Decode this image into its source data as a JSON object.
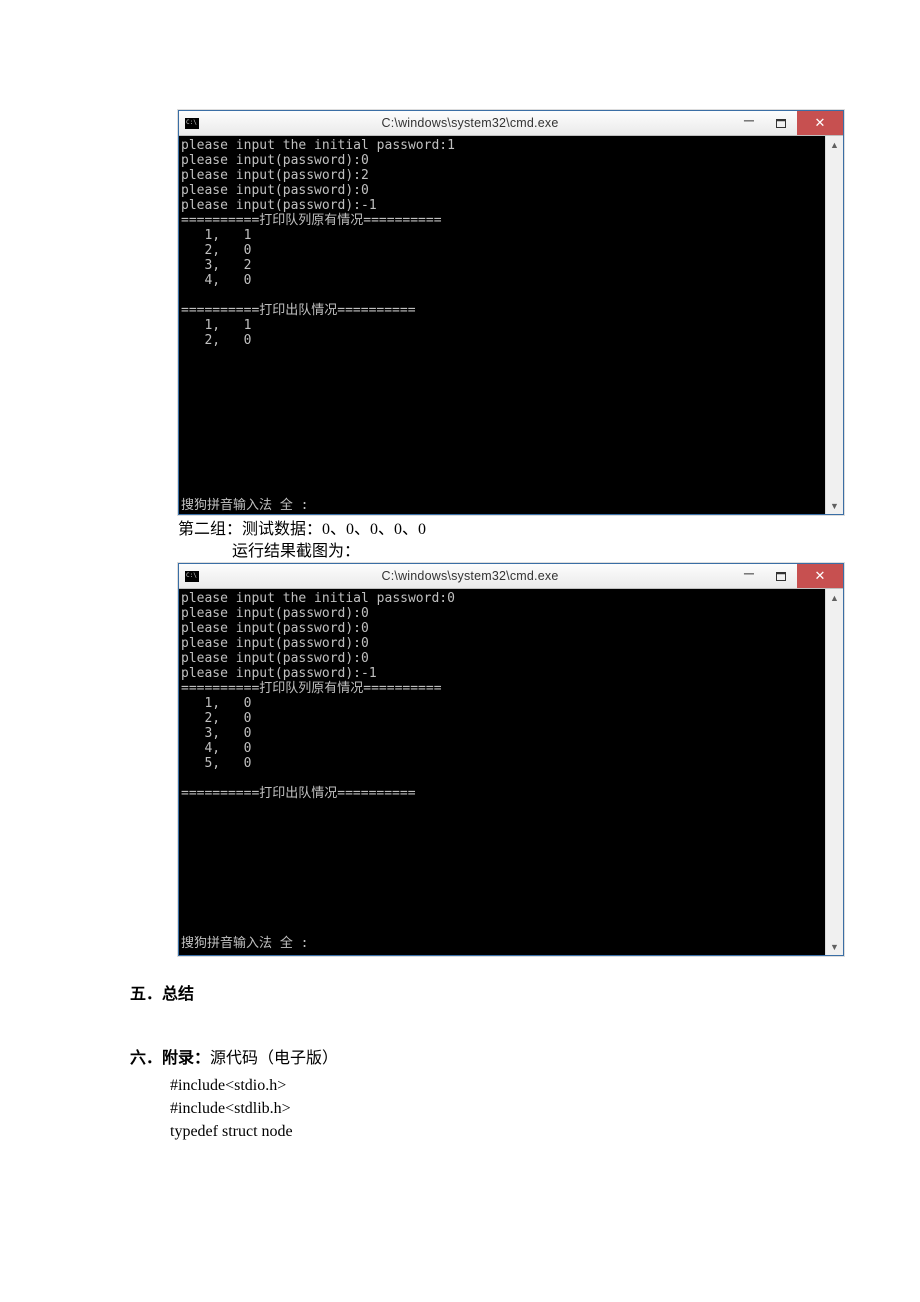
{
  "window_title": "C:\\windows\\system32\\cmd.exe",
  "console1_text": "please input the initial password:1\nplease input(password):0\nplease input(password):2\nplease input(password):0\nplease input(password):-1\n==========打印队列原有情况==========\n   1,   1\n   2,   0\n   3,   2\n   4,   0\n\n==========打印出队情况==========\n   1,   1\n   2,   0\n\n\n\n\n\n\n\n\n\n\n搜狗拼音输入法 全 :",
  "caption1": "第二组：测试数据：0、0、0、0、0",
  "caption1_sub": "运行结果截图为：",
  "console2_text": "please input the initial password:0\nplease input(password):0\nplease input(password):0\nplease input(password):0\nplease input(password):0\nplease input(password):-1\n==========打印队列原有情况==========\n   1,   0\n   2,   0\n   3,   0\n   4,   0\n   5,   0\n\n==========打印出队情况==========\n\n\n\n\n\n\n\n\n\n搜狗拼音输入法 全 :",
  "heading5": "五．总结",
  "heading6_bold": "六．附录：",
  "heading6_rest": "源代码（电子版）",
  "code": {
    "l1": "#include<stdio.h>",
    "l2": "#include<stdlib.h>",
    "l3": "typedef struct node"
  }
}
